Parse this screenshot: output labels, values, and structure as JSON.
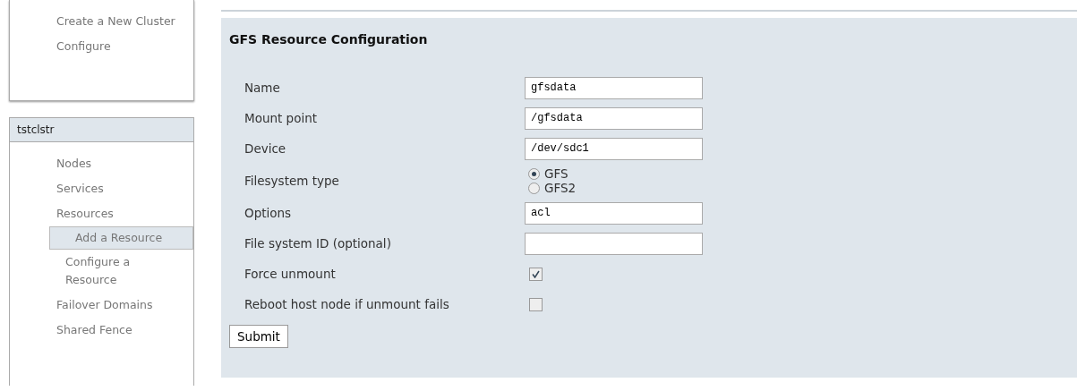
{
  "sidebar": {
    "top_items": [
      {
        "label": "Create a New Cluster",
        "selected": false
      },
      {
        "label": "Configure",
        "selected": false
      }
    ],
    "cluster": {
      "name": "tstclstr",
      "items": [
        {
          "label": "Nodes",
          "selected": false
        },
        {
          "label": "Services",
          "selected": false
        },
        {
          "label": "Resources",
          "selected": false,
          "children": [
            {
              "label": "Add a Resource",
              "selected": true
            },
            {
              "label": "Configure a Resource",
              "selected": false
            }
          ]
        },
        {
          "label": "Failover Domains",
          "selected": false
        },
        {
          "label": "Shared Fence",
          "selected": false
        }
      ]
    }
  },
  "form": {
    "title": "GFS Resource Configuration",
    "fields": [
      {
        "kind": "text",
        "label": "Name",
        "value": "gfsdata"
      },
      {
        "kind": "text",
        "label": "Mount point",
        "value": "/gfsdata"
      },
      {
        "kind": "text",
        "label": "Device",
        "value": "/dev/sdc1"
      },
      {
        "kind": "radio",
        "label": "Filesystem type",
        "options": [
          {
            "label": "GFS",
            "selected": true
          },
          {
            "label": "GFS2",
            "selected": false
          }
        ]
      },
      {
        "kind": "text",
        "label": "Options",
        "value": "acl"
      },
      {
        "kind": "text",
        "label": "File system ID (optional)"
      },
      {
        "kind": "checkbox",
        "label": "Force unmount",
        "checked": true
      },
      {
        "kind": "checkbox",
        "label": "Reboot host node if unmount fails",
        "checked": false
      }
    ],
    "submit": "Submit"
  }
}
